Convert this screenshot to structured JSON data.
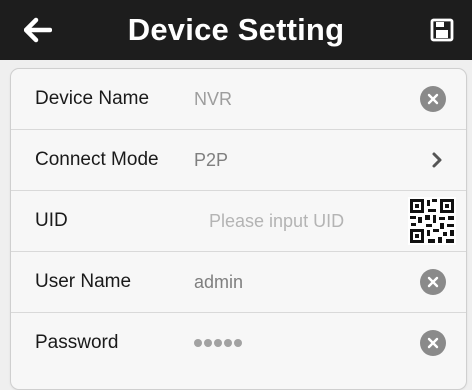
{
  "header": {
    "title": "Device Setting",
    "back_icon": "arrow-left-icon",
    "save_icon": "floppy-disk-icon"
  },
  "form": {
    "device_name": {
      "label": "Device Name",
      "value": "NVR"
    },
    "connect_mode": {
      "label": "Connect Mode",
      "value": "P2P",
      "icon": "chevron-right-icon"
    },
    "uid": {
      "label": "UID",
      "placeholder": "Please input UID",
      "icon": "qr-code-icon"
    },
    "user_name": {
      "label": "User Name",
      "value": "admin"
    },
    "password": {
      "label": "Password",
      "value": "•••••"
    },
    "clear_icon": "clear-circle-icon"
  },
  "colors": {
    "header_bg": "#1d1d1d",
    "page_bg": "#efefef",
    "panel_bg": "#f7f7f7",
    "icon_gray": "#8a8a8a"
  }
}
